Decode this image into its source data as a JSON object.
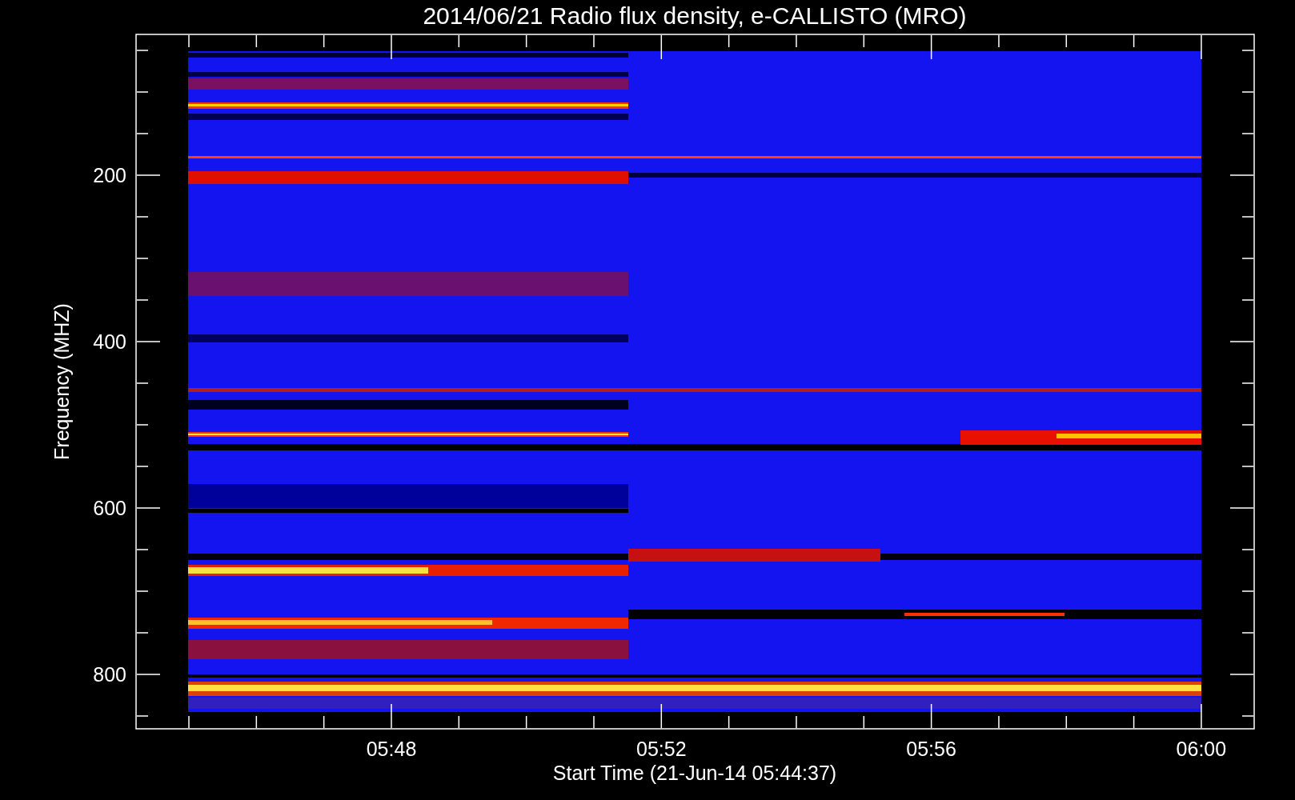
{
  "title": "2014/06/21  Radio flux density, e-CALLISTO (MRO)",
  "y_axis": {
    "label": "Frequency (MHZ)",
    "ticks": [
      "200",
      "400",
      "600",
      "800"
    ]
  },
  "x_axis": {
    "label": "Start Time (21-Jun-14 05:44:37)",
    "ticks": [
      "05:48",
      "05:52",
      "05:56",
      "06:00"
    ]
  }
}
